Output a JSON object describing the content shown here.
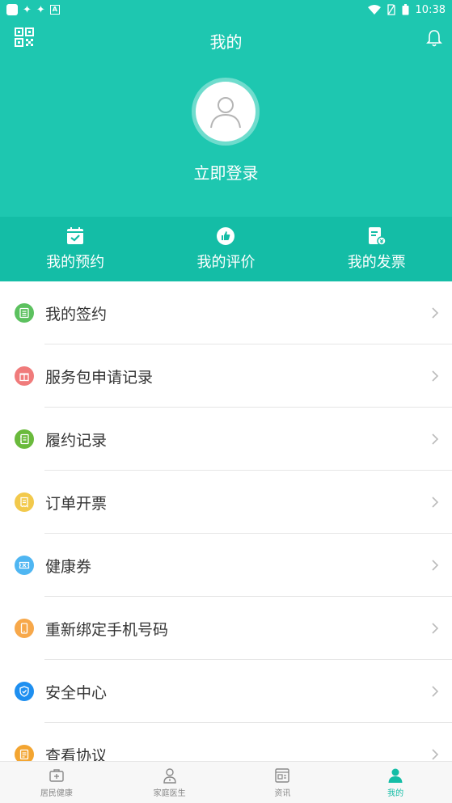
{
  "status": {
    "time": "10:38",
    "a_label": "A"
  },
  "header": {
    "title": "我的",
    "login_label": "立即登录"
  },
  "quick": [
    {
      "label": "我的预约",
      "icon": "calendar-check-icon"
    },
    {
      "label": "我的评价",
      "icon": "thumbs-up-icon"
    },
    {
      "label": "我的发票",
      "icon": "invoice-icon"
    }
  ],
  "menu": [
    {
      "label": "我的签约",
      "icon": "contract-list-icon",
      "color": "#5cc15f"
    },
    {
      "label": "服务包申请记录",
      "icon": "gift-icon",
      "color": "#f07b7b"
    },
    {
      "label": "履约记录",
      "icon": "notebook-icon",
      "color": "#6aba3c"
    },
    {
      "label": "订单开票",
      "icon": "receipt-icon",
      "color": "#f2c94c"
    },
    {
      "label": "健康券",
      "icon": "ticket-icon",
      "color": "#4fb6f2"
    },
    {
      "label": "重新绑定手机号码",
      "icon": "phone-icon",
      "color": "#f7a84a"
    },
    {
      "label": "安全中心",
      "icon": "shield-icon",
      "color": "#1e8ff0"
    },
    {
      "label": "查看协议",
      "icon": "document-icon",
      "color": "#f3a531"
    }
  ],
  "tabs": [
    {
      "label": "居民健康",
      "icon": "medkit-icon"
    },
    {
      "label": "家庭医生",
      "icon": "doctor-icon"
    },
    {
      "label": "资讯",
      "icon": "news-icon"
    },
    {
      "label": "我的",
      "icon": "person-icon",
      "active": true
    }
  ],
  "colors": {
    "primary": "#1ec7b0",
    "primary_dark": "#14bda6"
  }
}
